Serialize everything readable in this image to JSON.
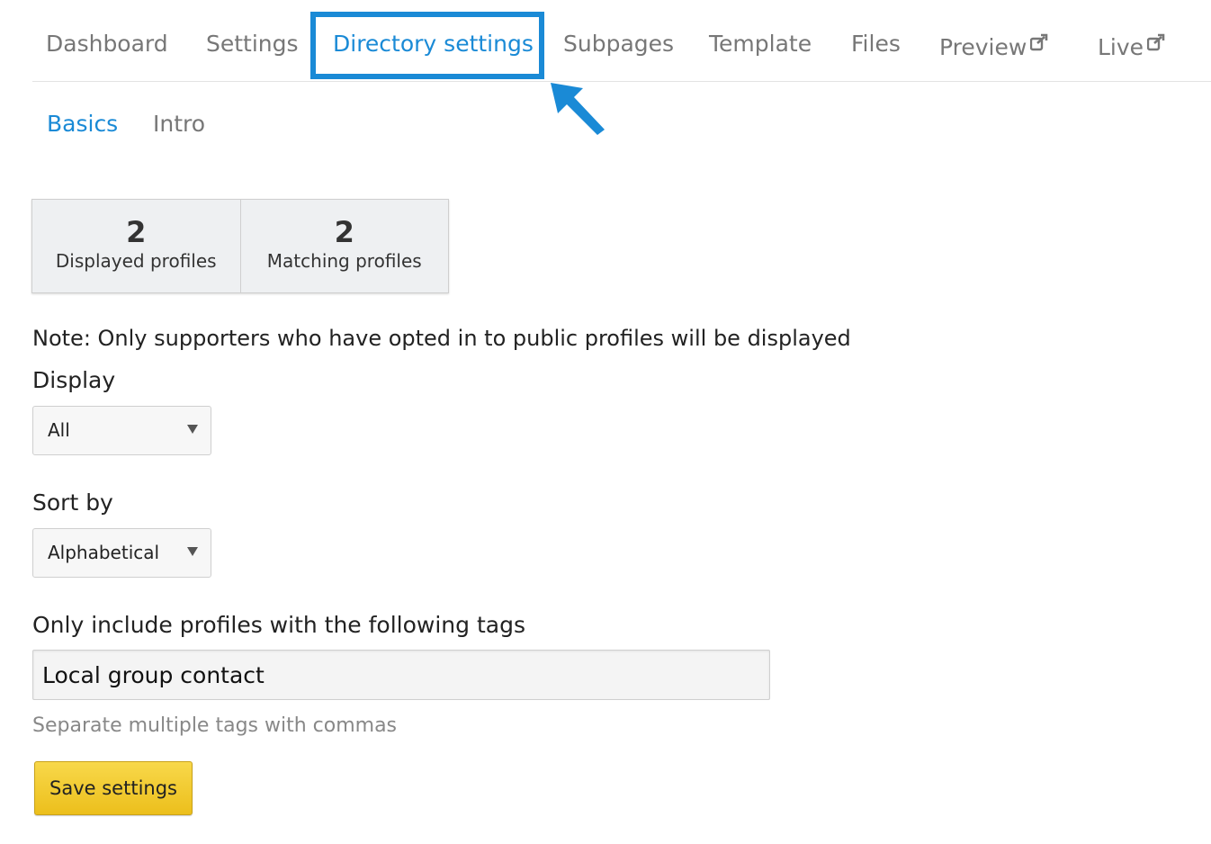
{
  "top_tabs": {
    "dashboard": "Dashboard",
    "settings": "Settings",
    "directory_settings": "Directory settings",
    "subpages": "Subpages",
    "template": "Template",
    "files": "Files",
    "preview": "Preview",
    "live": "Live"
  },
  "sub_tabs": {
    "basics": "Basics",
    "intro": "Intro"
  },
  "stats": [
    {
      "value": "2",
      "label": "Displayed profiles"
    },
    {
      "value": "2",
      "label": "Matching profiles"
    }
  ],
  "note": "Note: Only supporters who have opted in to public profiles will be displayed",
  "display": {
    "label": "Display",
    "selected": "All"
  },
  "sort_by": {
    "label": "Sort by",
    "selected": "Alphabetical"
  },
  "tags": {
    "label": "Only include profiles with the following tags",
    "value": "Local group contact",
    "help": "Separate multiple tags with commas"
  },
  "save_label": "Save settings",
  "colors": {
    "accent": "#1a8ad6",
    "button": "#f2c829"
  },
  "icons": {
    "external_link": "external-link-icon",
    "pointer_arrow": "pointer-arrow-icon"
  }
}
